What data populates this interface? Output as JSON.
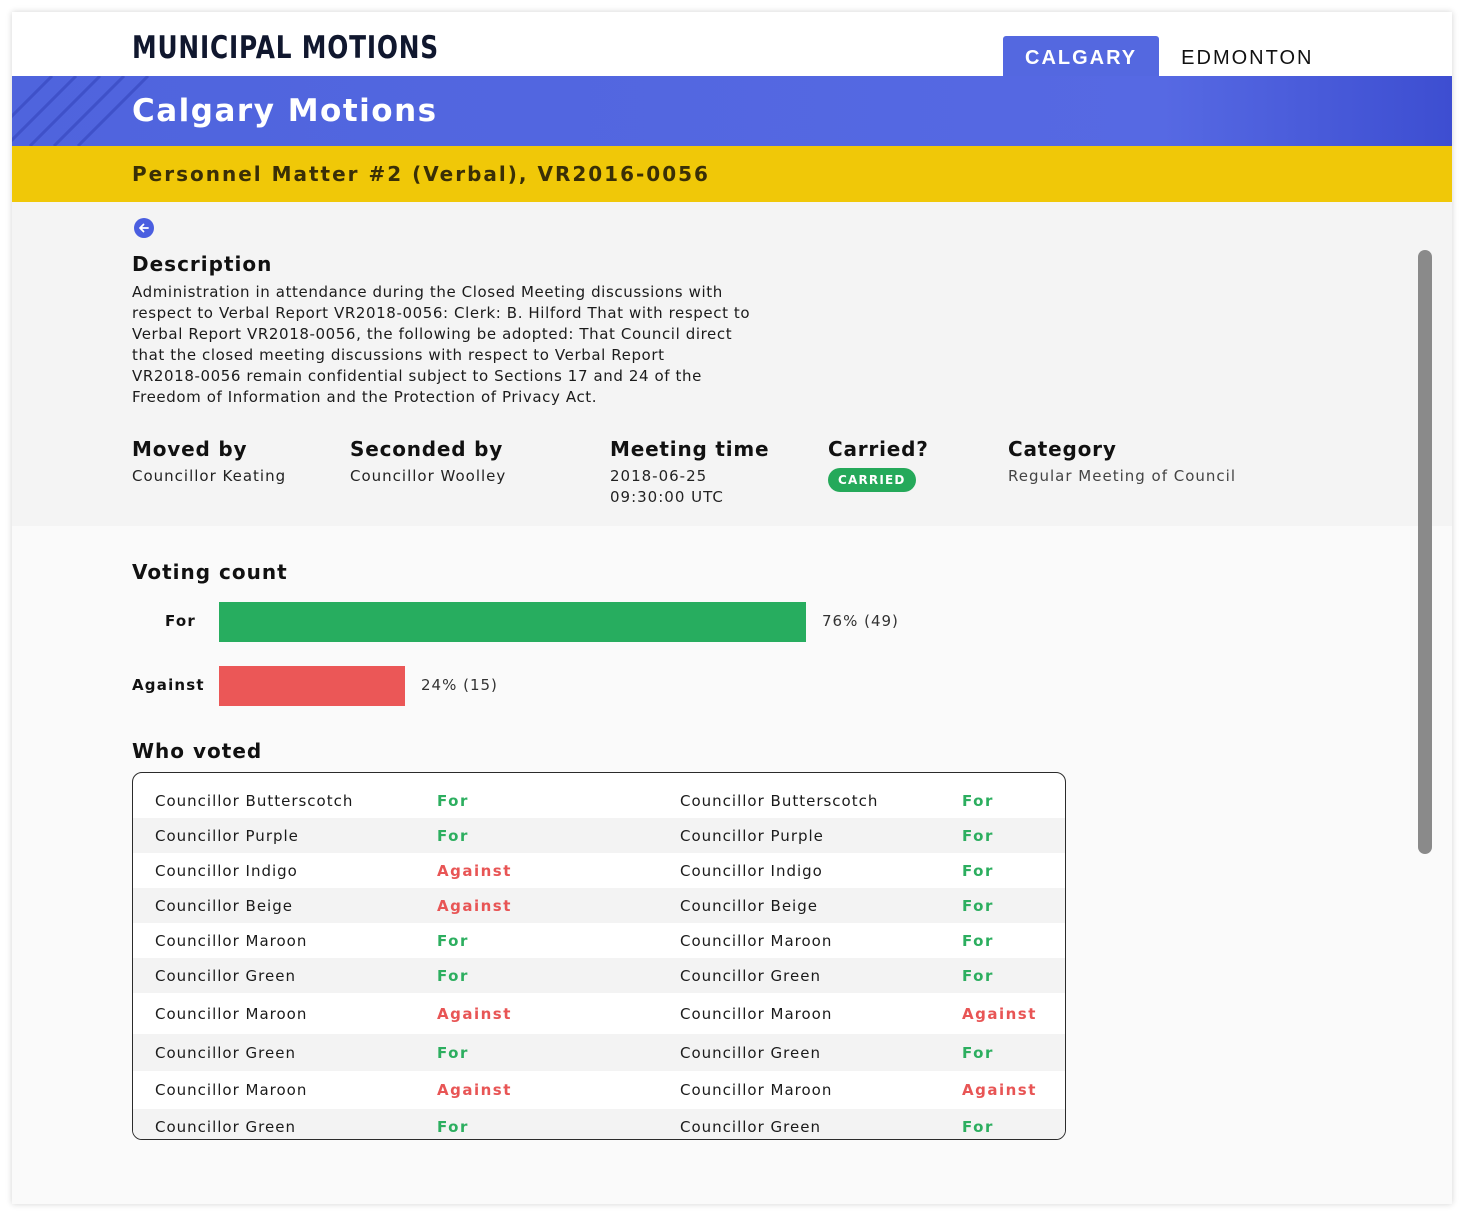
{
  "app": {
    "logo": "MUNICIPAL MOTIONS"
  },
  "tabs": [
    {
      "label": "CALGARY",
      "active": true
    },
    {
      "label": "EDMONTON",
      "active": false
    }
  ],
  "banner": {
    "title": "Calgary Motions"
  },
  "motion": {
    "title": "Personnel Matter #2 (Verbal), VR2016-0056"
  },
  "back_icon": "arrow-left-icon",
  "description": {
    "heading": "Description",
    "lines": [
      "Administration in attendance during the Closed Meeting discussions with",
      "respect to Verbal Report VR2018-0056: Clerk: B. Hilford That with respect to",
      "Verbal Report VR2018-0056, the following be adopted: That Council direct",
      "that the closed meeting discussions with respect to Verbal Report",
      "VR2018-0056 remain confidential subject to Sections 17 and 24 of the",
      "Freedom of Information and the Protection of Privacy Act."
    ]
  },
  "meta": {
    "moved_by": {
      "label": "Moved by",
      "value": "Councillor Keating"
    },
    "seconded_by": {
      "label": "Seconded by",
      "value": "Councillor Woolley"
    },
    "meeting_time": {
      "label": "Meeting time",
      "date": "2018-06-25",
      "time": "09:30:00 UTC"
    },
    "carried": {
      "label": "Carried?",
      "badge": "CARRIED"
    },
    "category": {
      "label": "Category",
      "value": "Regular Meeting of Council"
    }
  },
  "voting": {
    "heading": "Voting count",
    "bars": [
      {
        "label": "For",
        "percent": 76,
        "count": 49,
        "text": "76% (49)"
      },
      {
        "label": "Against",
        "percent": 24,
        "count": 15,
        "text": "24% (15)"
      }
    ]
  },
  "who_voted": {
    "heading": "Who voted",
    "rows": [
      {
        "left": {
          "name": "Councillor Butterscotch",
          "vote": "For"
        },
        "right": {
          "name": "Councillor Butterscotch",
          "vote": "For"
        }
      },
      {
        "left": {
          "name": "Councillor Purple",
          "vote": "For"
        },
        "right": {
          "name": "Councillor Purple",
          "vote": "For"
        }
      },
      {
        "left": {
          "name": "Councillor Indigo",
          "vote": "Against"
        },
        "right": {
          "name": "Councillor Indigo",
          "vote": "For"
        }
      },
      {
        "left": {
          "name": "Councillor Beige",
          "vote": "Against"
        },
        "right": {
          "name": "Councillor Beige",
          "vote": "For"
        }
      },
      {
        "left": {
          "name": "Councillor Maroon",
          "vote": "For"
        },
        "right": {
          "name": "Councillor Maroon",
          "vote": "For"
        }
      },
      {
        "left": {
          "name": "Councillor Green",
          "vote": "For"
        },
        "right": {
          "name": "Councillor Green",
          "vote": "For"
        }
      },
      {
        "left": {
          "name": "Councillor Maroon",
          "vote": "Against"
        },
        "right": {
          "name": "Councillor Maroon",
          "vote": "Against"
        }
      },
      {
        "left": {
          "name": "Councillor Green",
          "vote": "For"
        },
        "right": {
          "name": "Councillor Green",
          "vote": "For"
        }
      },
      {
        "left": {
          "name": "Councillor Maroon",
          "vote": "Against"
        },
        "right": {
          "name": "Councillor Maroon",
          "vote": "Against"
        }
      },
      {
        "left": {
          "name": "Councillor Green",
          "vote": "For"
        },
        "right": {
          "name": "Councillor Green",
          "vote": "For"
        }
      }
    ]
  },
  "colors": {
    "brand_blue": "#5468e0",
    "motion_yellow": "#f0c808",
    "for_green": "#25a95a",
    "against_red": "#eb5757"
  }
}
